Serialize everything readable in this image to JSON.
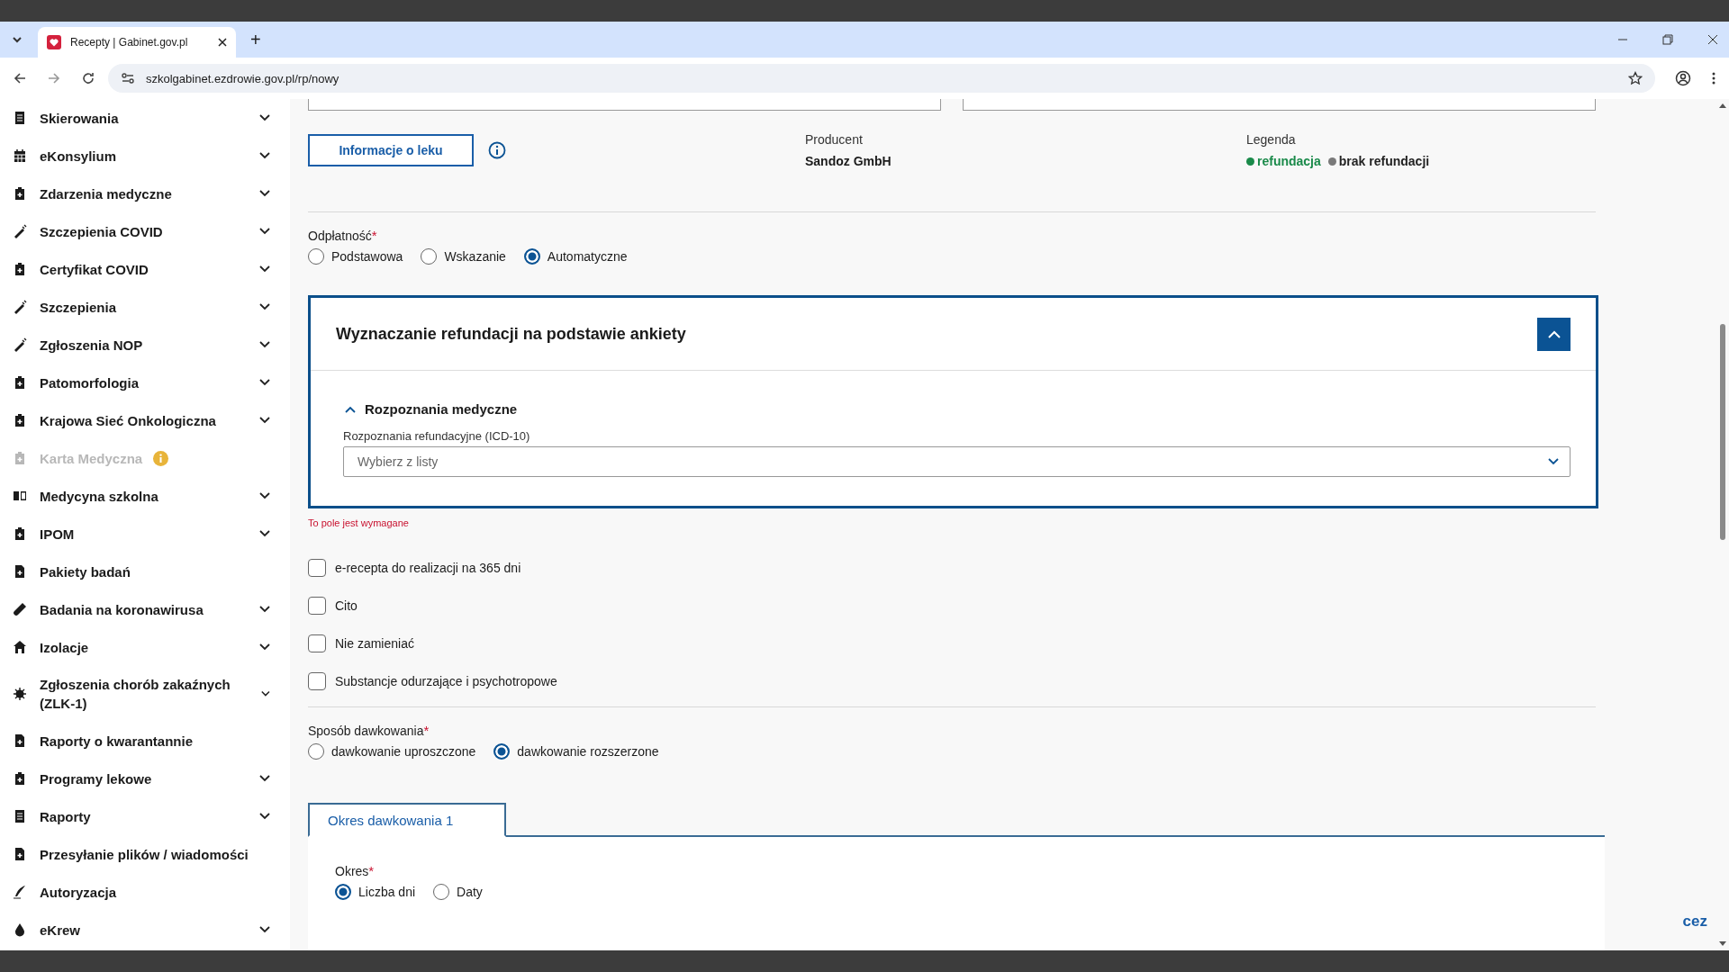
{
  "browser": {
    "tab_title": "Recepty | Gabinet.gov.pl",
    "new_tab": "+",
    "url": "szkolgabinet.ezdrowie.gov.pl/rp/nowy"
  },
  "sidebar": {
    "items": [
      {
        "label": "Skierowania",
        "expandable": true,
        "disabled": false,
        "info": false
      },
      {
        "label": "eKonsylium",
        "expandable": true,
        "disabled": false,
        "info": false
      },
      {
        "label": "Zdarzenia medyczne",
        "expandable": true,
        "disabled": false,
        "info": false
      },
      {
        "label": "Szczepienia COVID",
        "expandable": true,
        "disabled": false,
        "info": false
      },
      {
        "label": "Certyfikat COVID",
        "expandable": true,
        "disabled": false,
        "info": false
      },
      {
        "label": "Szczepienia",
        "expandable": true,
        "disabled": false,
        "info": false
      },
      {
        "label": "Zgłoszenia NOP",
        "expandable": true,
        "disabled": false,
        "info": false
      },
      {
        "label": "Patomorfologia",
        "expandable": true,
        "disabled": false,
        "info": false
      },
      {
        "label": "Krajowa Sieć Onkologiczna",
        "expandable": true,
        "disabled": false,
        "info": false
      },
      {
        "label": "Karta Medyczna",
        "expandable": false,
        "disabled": true,
        "info": true
      },
      {
        "label": "Medycyna szkolna",
        "expandable": true,
        "disabled": false,
        "info": false
      },
      {
        "label": "IPOM",
        "expandable": true,
        "disabled": false,
        "info": false
      },
      {
        "label": "Pakiety badań",
        "expandable": false,
        "disabled": false,
        "info": false
      },
      {
        "label": "Badania na koronawirusa",
        "expandable": true,
        "disabled": false,
        "info": false
      },
      {
        "label": "Izolacje",
        "expandable": true,
        "disabled": false,
        "info": false
      },
      {
        "label": "Zgłoszenia chorób zakaźnych (ZLK-1)",
        "expandable": true,
        "disabled": false,
        "info": false
      },
      {
        "label": "Raporty o kwarantannie",
        "expandable": false,
        "disabled": false,
        "info": false
      },
      {
        "label": "Programy lekowe",
        "expandable": true,
        "disabled": false,
        "info": false
      },
      {
        "label": "Raporty",
        "expandable": true,
        "disabled": false,
        "info": false
      },
      {
        "label": "Przesyłanie plików / wiadomości",
        "expandable": false,
        "disabled": false,
        "info": false
      },
      {
        "label": "Autoryzacja",
        "expandable": false,
        "disabled": false,
        "info": false
      },
      {
        "label": "eKrew",
        "expandable": true,
        "disabled": false,
        "info": false
      }
    ]
  },
  "drug": {
    "info_button": "Informacje o leku",
    "producer_label": "Producent",
    "producer": "Sandoz GmbH",
    "legend_label": "Legenda",
    "legend": [
      {
        "label": "refundacja",
        "color": "#1a8a4a"
      },
      {
        "label": "brak refundacji",
        "color": "#7a7a7a"
      }
    ]
  },
  "payment": {
    "label": "Odpłatność",
    "required": "*",
    "options": [
      {
        "label": "Podstawowa",
        "selected": false
      },
      {
        "label": "Wskazanie",
        "selected": false
      },
      {
        "label": "Automatyczne",
        "selected": true
      }
    ]
  },
  "refund_panel": {
    "title": "Wyznaczanie refundacji na podstawie ankiety",
    "expanded": true,
    "section": {
      "title": "Rozpoznania medyczne",
      "expanded": true
    },
    "field_label": "Rozpoznania refundacyjne (ICD-10)",
    "placeholder": "Wybierz z listy",
    "error": "To pole jest wymagane"
  },
  "checkboxes": [
    {
      "label": "e-recepta do realizacji na 365 dni",
      "checked": false
    },
    {
      "label": "Cito",
      "checked": false
    },
    {
      "label": "Nie zamieniać",
      "checked": false
    },
    {
      "label": "Substancje odurzające i psychotropowe",
      "checked": false
    }
  ],
  "dosage": {
    "label": "Sposób dawkowania",
    "required": "*",
    "options": [
      {
        "label": "dawkowanie uproszczone",
        "selected": false
      },
      {
        "label": "dawkowanie rozszerzone",
        "selected": true
      }
    ]
  },
  "dosage_tabs": [
    {
      "label": "Okres dawkowania 1",
      "selected": true
    }
  ],
  "period": {
    "label": "Okres",
    "required": "*",
    "options": [
      {
        "label": "Liczba dni",
        "selected": true
      },
      {
        "label": "Daty",
        "selected": false
      }
    ]
  },
  "corner_logo": "cez"
}
